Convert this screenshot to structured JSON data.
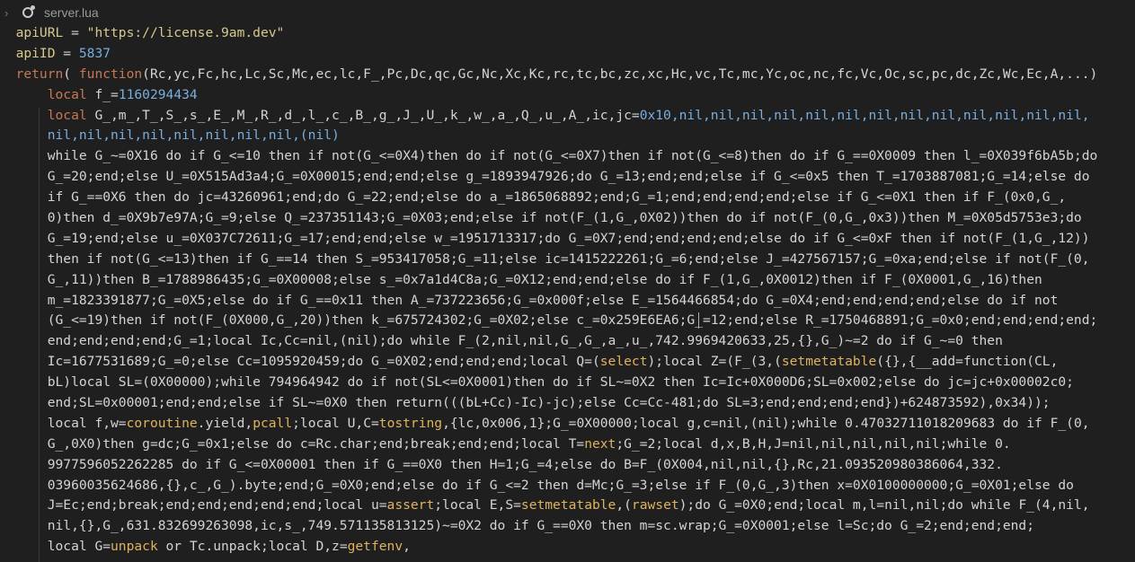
{
  "tab": {
    "filename": "server.lua"
  },
  "editor": {
    "lines": [
      [
        {
          "t": "apiURL",
          "c": "id"
        },
        {
          "t": " = ",
          "c": "w"
        },
        {
          "t": "\"https://license.9am.dev\"",
          "c": "str"
        }
      ],
      [
        {
          "t": "apiID",
          "c": "id"
        },
        {
          "t": " = ",
          "c": "w"
        },
        {
          "t": "5837",
          "c": "num"
        }
      ],
      [
        {
          "t": "return",
          "c": "kw"
        },
        {
          "t": "( ",
          "c": "w"
        },
        {
          "t": "function",
          "c": "kw"
        },
        {
          "t": "(Rc,yc,Fc,hc,Lc,Sc,Mc,ec,lc,F_,Pc,Dc,qc,Gc,Nc,Xc,Kc,rc,tc,bc,zc,xc,Hc,vc,Tc,mc,Yc,oc,nc,fc,Vc,Oc,sc,pc,dc,Zc,Wc,Ec,A,...)",
          "c": "w"
        }
      ],
      [
        {
          "t": "    local ",
          "c": "kw"
        },
        {
          "t": "f_=",
          "c": "w"
        },
        {
          "t": "1160294434",
          "c": "num"
        }
      ],
      [
        {
          "t": "    local ",
          "c": "kw"
        },
        {
          "t": "G_,m_,T_,S_,s_,E_,M_,R_,d_,l_,c_,B_,g_,J_,U_,k_,w_,a_,Q_,u_,A_,ic,jc=",
          "c": "w"
        },
        {
          "t": "0x10,nil,nil,nil,nil,nil,nil,nil,nil,nil,nil,nil,nil,nil,",
          "c": "num"
        }
      ],
      [
        {
          "t": "    nil,nil,nil,nil,nil,nil,nil,nil,(nil)",
          "c": "num"
        }
      ],
      [
        {
          "t": "    while G_~=0X16 do if G_<=10 then if not(G_<=0X4)then do if not(G_<=0X7)then if not(G_<=8)then do if G_==0X0009 then l_=0X039f6bA5b;do",
          "c": "w"
        }
      ],
      [
        {
          "t": "    G_=20;end;else U_=0X515Ad3a4;G_=0X00015;end;end;else g_=1893947926;do G_=13;end;end;else if G_<=0x5 then T_=1703887081;G_=14;else do",
          "c": "w"
        }
      ],
      [
        {
          "t": "    if G_==0X6 then do jc=43260961;end;do G_=22;end;else do a_=1865068892;end;G_=1;end;end;end;end;else if G_<=0X1 then if F_(0x0,G_,",
          "c": "w"
        }
      ],
      [
        {
          "t": "    0)then d_=0X9b7e97A;G_=9;else Q_=237351143;G_=0X03;end;else if not(F_(1,G_,0X02))then do if not(F_(0,G_,0x3))then M_=0X05d5753e3;do",
          "c": "w"
        }
      ],
      [
        {
          "t": "    G_=19;end;else u_=0X037C72611;G_=17;end;end;else w_=1951713317;do G_=0X7;end;end;end;end;else do if G_<=0xF then if not(F_(1,G_,12))",
          "c": "w"
        }
      ],
      [
        {
          "t": "    then if not(G_<=13)then if G_==14 then S_=953417058;G_=11;else ic=1415222261;G_=6;end;else J_=427567157;G_=0xa;end;else if not(F_(0,",
          "c": "w"
        }
      ],
      [
        {
          "t": "    G_,11))then B_=1788986435;G_=0X00008;else s_=0x7a1d4C8a;G_=0X12;end;end;else do if F_(1,G_,0X0012)then if F_(0X0001,G_,16)then",
          "c": "w"
        }
      ],
      [
        {
          "t": "    m_=1823391877;G_=0X5;else do if G_==0x11 then A_=737223656;G_=0x000f;else E_=1564466854;do G_=0X4;end;end;end;end;else do if not",
          "c": "w"
        }
      ],
      [
        {
          "t": "    (G_<=19)then if not(F_(0X000,G_,20))then k_=675724302;G_=0X02;else c_=0x259E6EA6;G_=12;end;else R_=1750468891;G_=0x0;end;end;end;end;",
          "c": "w"
        }
      ],
      [
        {
          "t": "    end;end;end;end;G_=1;local Ic,Cc=nil,(nil);do while F_(2,nil,nil,G_,G_,a_,u_,742.9969420633,25,{},G_)~=2 do if G_~=0 then",
          "c": "w"
        }
      ],
      [
        {
          "t": "    Ic=1677531689;G_=0;else Cc=1095920459;do G_=0X02;end;end;end;local Q=(",
          "c": "w"
        },
        {
          "t": "select",
          "c": "fn"
        },
        {
          "t": ");local Z=(F_(3,(",
          "c": "w"
        },
        {
          "t": "setmetatable",
          "c": "fn"
        },
        {
          "t": "({},{__add=function(CL,",
          "c": "w"
        }
      ],
      [
        {
          "t": "    bL)local SL=(0X00000);while 794964942 do if not(SL<=0X0001)then do if SL~=0X2 then Ic=Ic+0X000D6;SL=0x002;else do jc=jc+0x00002c0;",
          "c": "w"
        }
      ],
      [
        {
          "t": "    end;SL=0x00001;end;end;else if SL~=0X0 then return(((bL+Cc)-Ic)-jc);else Cc=Cc-481;do SL=3;end;end;end;end})+624873592),0x34));",
          "c": "w"
        }
      ],
      [
        {
          "t": "    local f,w=",
          "c": "w"
        },
        {
          "t": "coroutine",
          "c": "fn"
        },
        {
          "t": ".yield,",
          "c": "w"
        },
        {
          "t": "pcall",
          "c": "fn"
        },
        {
          "t": ";local U,C=",
          "c": "w"
        },
        {
          "t": "tostring",
          "c": "fn"
        },
        {
          "t": ",{lc,0x006,1};G_=0X00000;local g,c=nil,(nil);while 0.47032711018209683 do if F_(0,",
          "c": "w"
        }
      ],
      [
        {
          "t": "    G_,0X0)then g=dc;G_=0x1;else do c=Rc.char;end;break;end;end;local T=",
          "c": "w"
        },
        {
          "t": "next",
          "c": "fn"
        },
        {
          "t": ";G_=2;local d,x,B,H,J=nil,nil,nil,nil,nil;while 0.",
          "c": "w"
        }
      ],
      [
        {
          "t": "    9977596052262285 do if G_<=0X00001 then if G_==0X0 then H=1;G_=4;else do B=F_(0X004,nil,nil,{},Rc,21.093520980386064,332.",
          "c": "w"
        }
      ],
      [
        {
          "t": "    03960035624686,{},c_,G_).byte;end;G_=0X0;end;else do if G_<=2 then d=Mc;G_=3;else if F_(0,G_,3)then x=0X0100000000;G_=0X01;else do",
          "c": "w"
        }
      ],
      [
        {
          "t": "    J=Ec;end;break;end;end;end;end;end;local u=",
          "c": "w"
        },
        {
          "t": "assert",
          "c": "fn"
        },
        {
          "t": ";local E,S=",
          "c": "w"
        },
        {
          "t": "setmetatable",
          "c": "fn"
        },
        {
          "t": ",(",
          "c": "w"
        },
        {
          "t": "rawset",
          "c": "fn"
        },
        {
          "t": ");do G_=0X0;end;local m,l=nil,nil;do while F_(4,nil,",
          "c": "w"
        }
      ],
      [
        {
          "t": "    nil,{},G_,631.832699263098,ic,s_,749.571135813125)~=0X2 do if G_==0X0 then m=sc.wrap;G_=0X0001;else l=Sc;do G_=2;end;end;end;",
          "c": "w"
        }
      ],
      [
        {
          "t": "    local G=",
          "c": "w"
        },
        {
          "t": "unpack",
          "c": "fn"
        },
        {
          "t": " or Tc.unpack;local D,z=",
          "c": "w"
        },
        {
          "t": "getfenv",
          "c": "fn"
        },
        {
          "t": ",",
          "c": "w"
        }
      ]
    ]
  }
}
